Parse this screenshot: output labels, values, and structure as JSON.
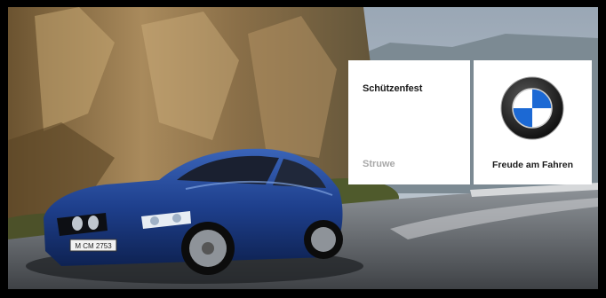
{
  "ad": {
    "headline": "Schützenfest",
    "author": "Struwe",
    "slogan": "Freude am Fahren",
    "plate": "M CM 2753"
  },
  "colors": {
    "car": "#1e3f8c",
    "background": "#000000",
    "card": "#ffffff",
    "bmw_blue": "#1c69d4"
  },
  "icons": [
    "bmw-roundel-icon"
  ]
}
